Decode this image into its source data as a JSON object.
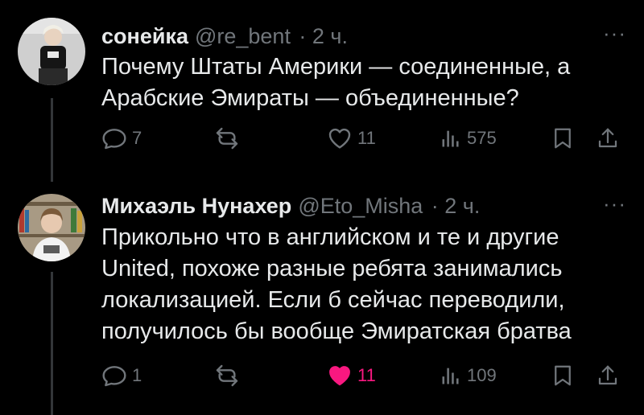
{
  "tweets": [
    {
      "name": "сонейка",
      "handle": "@re_bent",
      "time": "· 2 ч.",
      "text_lines": [
        "Почему Штаты Америки — соединенные, а",
        "Арабские Эмираты — объединенные?"
      ],
      "replies": "7",
      "retweets": "",
      "likes": "11",
      "liked": false,
      "views": "575"
    },
    {
      "name": "Михаэль Нунахер",
      "handle": "@Eto_Misha",
      "time": "· 2 ч.",
      "text_lines": [
        "Прикольно что в английском и те и другие",
        "United, похоже разные ребята занимались",
        "локализацией. Если б сейчас переводили,",
        "получилось бы вообще Эмиратская братва"
      ],
      "replies": "1",
      "retweets": "",
      "likes": "11",
      "liked": true,
      "views": "109"
    }
  ],
  "colors": {
    "background": "#000000",
    "text": "#e7e9ea",
    "muted": "#71767b",
    "like": "#f91880",
    "thread_line": "#333639"
  },
  "icons": [
    "reply-icon",
    "retweet-icon",
    "heart-icon",
    "views-icon",
    "bookmark-icon",
    "share-icon",
    "more-icon"
  ],
  "more_label": "···"
}
